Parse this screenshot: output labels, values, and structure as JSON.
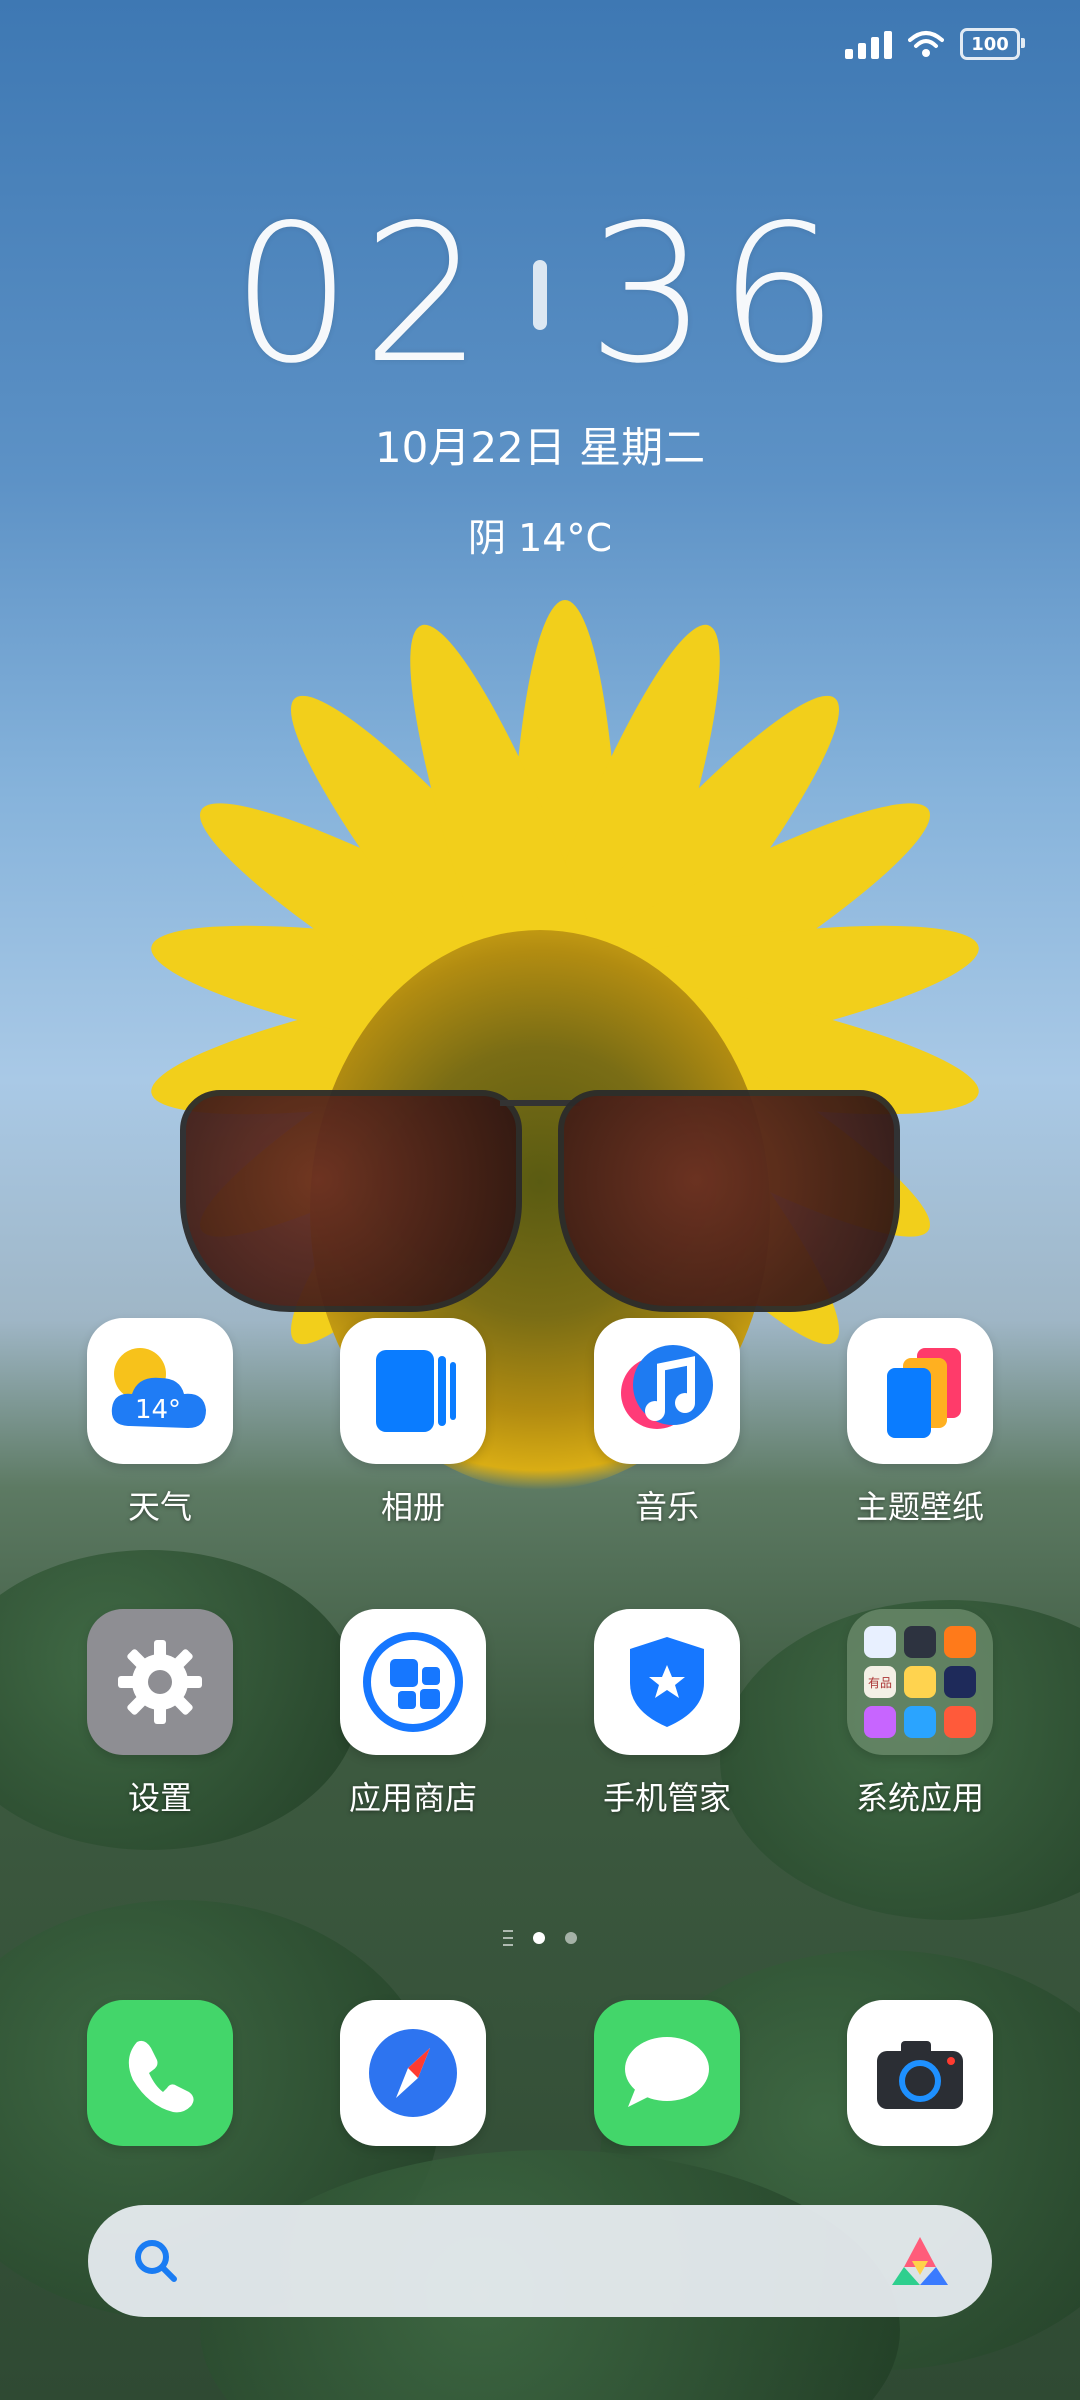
{
  "status_bar": {
    "battery": "100"
  },
  "clock": {
    "hours": "02",
    "minutes": "36",
    "date": "10月22日 星期二",
    "weather": "阴 14°C"
  },
  "apps_row1": [
    {
      "label": "天气",
      "icon": "weather-icon",
      "temp": "14°"
    },
    {
      "label": "相册",
      "icon": "gallery-icon"
    },
    {
      "label": "音乐",
      "icon": "music-icon"
    },
    {
      "label": "主题壁纸",
      "icon": "themes-icon"
    }
  ],
  "apps_row2": [
    {
      "label": "设置",
      "icon": "settings-gear-icon"
    },
    {
      "label": "应用商店",
      "icon": "app-store-icon"
    },
    {
      "label": "手机管家",
      "icon": "security-shield-icon"
    },
    {
      "label": "系统应用",
      "icon": "folder-icon",
      "mini_text": "有品"
    }
  ],
  "dock": [
    {
      "name": "phone",
      "icon": "phone-icon"
    },
    {
      "name": "browser",
      "icon": "compass-icon"
    },
    {
      "name": "messages",
      "icon": "message-icon"
    },
    {
      "name": "camera",
      "icon": "camera-icon"
    }
  ],
  "page_indicator": {
    "pages": 3,
    "active": 1
  },
  "colors": {
    "weather_blue": "#1f7cf5",
    "phone_green": "#43d66a",
    "accent_blue": "#0a84ff",
    "gear_gray": "#8e8e93"
  }
}
